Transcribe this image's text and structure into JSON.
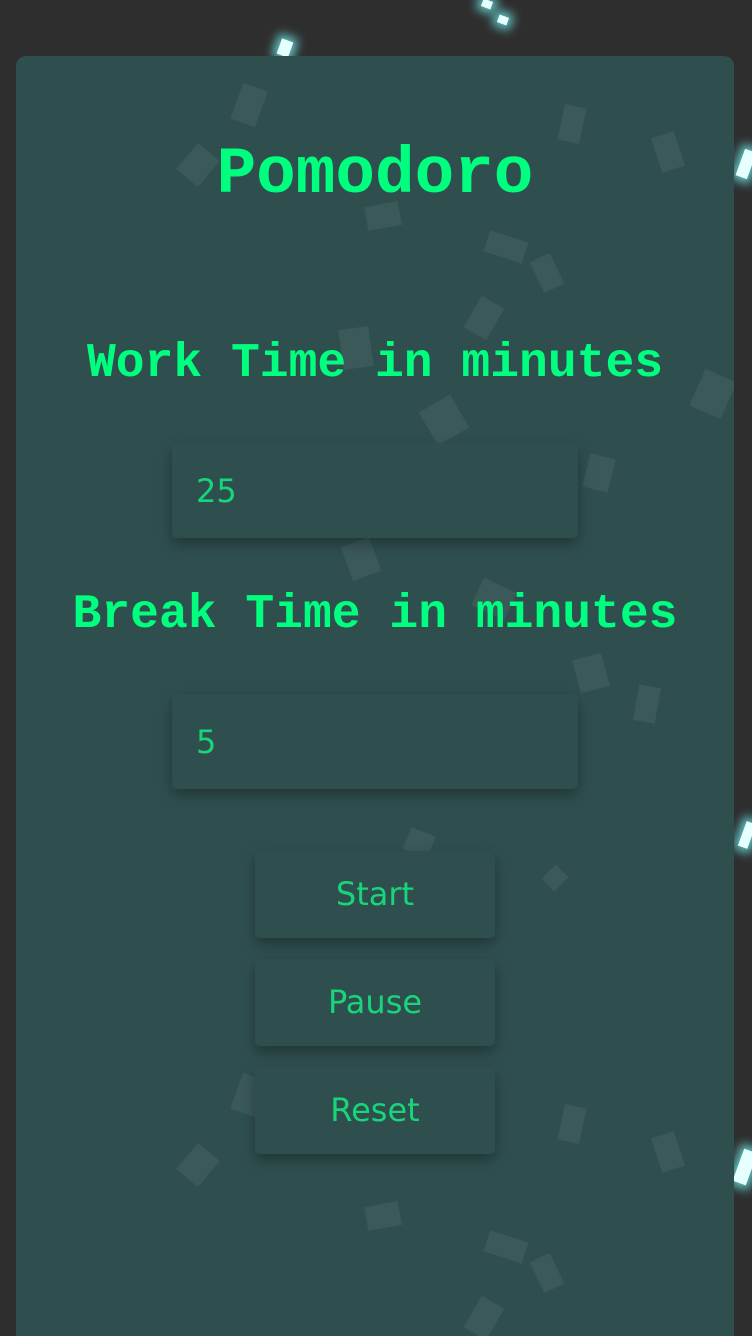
{
  "app": {
    "title": "Pomodoro"
  },
  "work": {
    "label": "Work Time in minutes",
    "value": "25"
  },
  "break": {
    "label": "Break Time in minutes",
    "value": "5"
  },
  "buttons": {
    "start": "Start",
    "pause": "Pause",
    "reset": "Reset"
  },
  "colors": {
    "page_background": "#2e2e2e",
    "card_background": "#2f4f4f",
    "heading_text": "#00ff7f",
    "control_text": "#17d67a",
    "sparkle": "#e6ffff"
  }
}
